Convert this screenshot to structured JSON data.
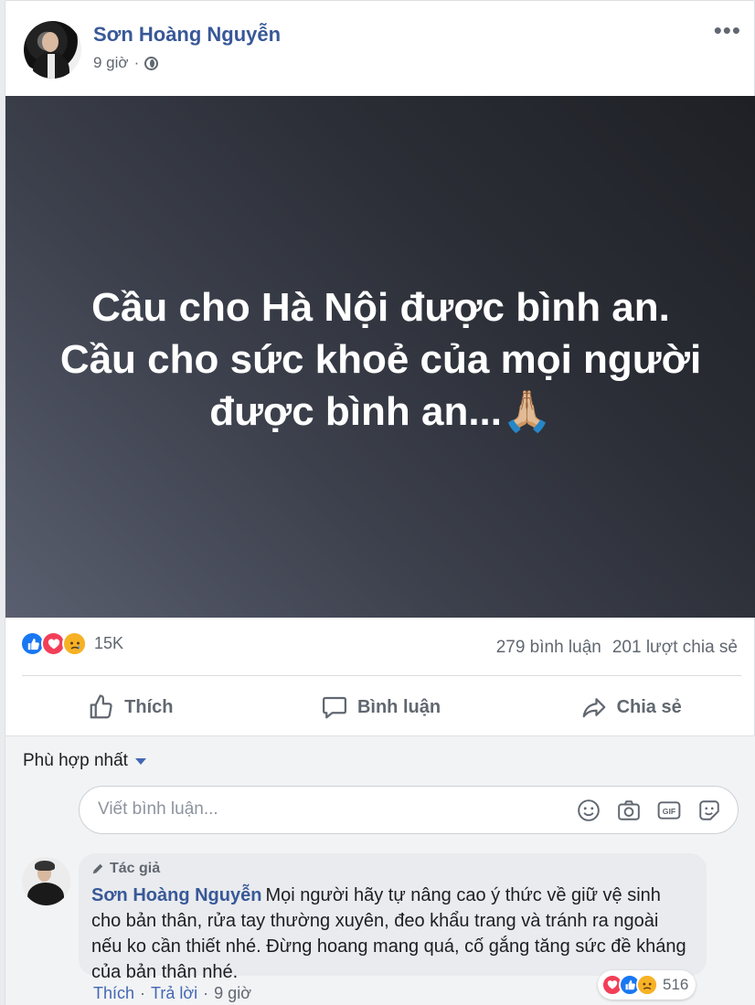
{
  "post": {
    "author": "Sơn Hoàng Nguyễn",
    "time": "9 giờ",
    "time_separator": "·",
    "text": "Cầu cho Hà Nội được bình an.\nCầu cho sức khoẻ của mọi người được bình an...🙏🏼",
    "colors": {
      "bg_start": "#5a5f6f",
      "bg_end": "#1e2025",
      "link": "#385898"
    }
  },
  "reactions": {
    "icons": [
      "like-icon",
      "love-icon",
      "sad-icon"
    ],
    "count": "15K",
    "comments": "279 bình luận",
    "shares": "201 lượt chia sẻ"
  },
  "actions": {
    "like": "Thích",
    "comment": "Bình luận",
    "share": "Chia sẻ"
  },
  "comments_section": {
    "sort_label": "Phù hợp nhất",
    "input_placeholder": "Viết bình luận...",
    "box_icons": [
      "emoji-icon",
      "camera-icon",
      "gif-icon",
      "sticker-icon"
    ]
  },
  "top_comment": {
    "badge": "Tác giả",
    "author": "Sơn Hoàng Nguyễn",
    "text": "Mọi người hãy tự nâng cao ý thức về giữ vệ sinh cho bản thân, rửa tay thường xuyên, đeo khẩu trang và tránh ra ngoài nếu ko cần thiết nhé. Đừng hoang mang quá, cố gắng tăng sức đề kháng của bản thân nhé.",
    "reaction_count": "516",
    "like_label": "Thích",
    "reply_label": "Trả lời",
    "time": "9 giờ",
    "separator": "·"
  }
}
